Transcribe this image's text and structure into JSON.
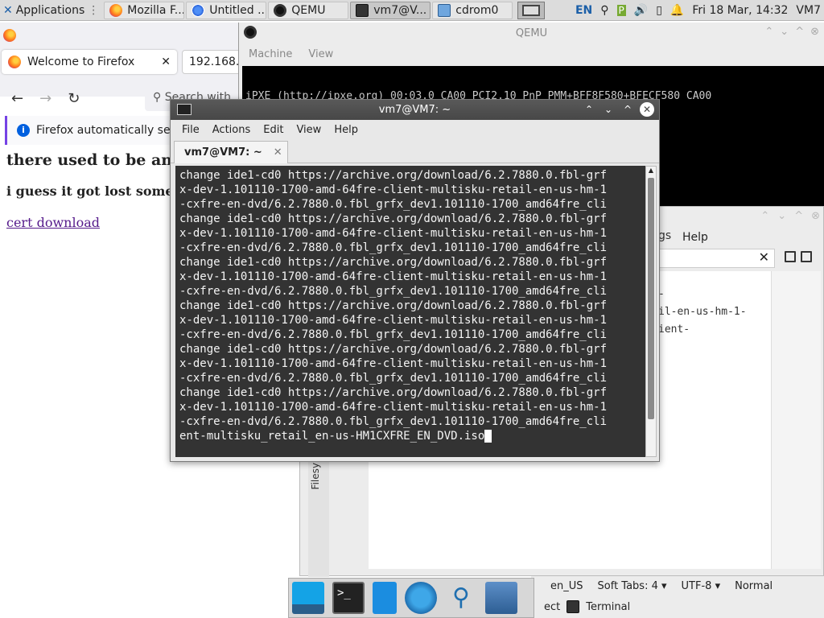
{
  "panel": {
    "applications_label": "Applications",
    "tasks": [
      {
        "label": "Mozilla F...",
        "icon": "firefox-icon"
      },
      {
        "label": "Untitled ...",
        "icon": "chromium-icon"
      },
      {
        "label": "QEMU",
        "icon": "qemu-icon"
      },
      {
        "label": "vm7@V...",
        "icon": "terminal-icon"
      },
      {
        "label": "cdrom0",
        "icon": "folder-icon"
      }
    ],
    "keyboard_layout": "EN",
    "datetime": "Fri 18 Mar, 14:32",
    "user": "VM7"
  },
  "firefox": {
    "tab_title": "Welcome to Firefox",
    "tab2_title": "192.168.",
    "search_placeholder": "Search with",
    "notice": "Firefox automatically sen",
    "heading": "there used to be an",
    "subheading": "i guess it got lost some",
    "link": "cert download"
  },
  "qemu": {
    "title": "QEMU",
    "menu": [
      "Machine",
      "View"
    ],
    "screen_text": "iPXE (http://ipxe.org) 00:03.0 CA00 PCI2.10 PnP PMM+BFF8F580+BFECF580 CA00"
  },
  "mousepad": {
    "menu_fragment": "gs",
    "help": "Help",
    "text_lines": [
      "-",
      "il-en-us-hm-1-",
      "",
      "ient-"
    ],
    "side_label": "Filesy"
  },
  "statusbar": {
    "language": "en_US",
    "tabs": "Soft Tabs: 4",
    "encoding": "UTF-8",
    "mode": "Normal"
  },
  "dockrow": {
    "fragment": "ect",
    "terminal_label": "Terminal"
  },
  "terminal": {
    "title": "vm7@VM7: ~",
    "menu": [
      "File",
      "Actions",
      "Edit",
      "View",
      "Help"
    ],
    "tab_label": "vm7@VM7: ~",
    "lines": [
      "change ide1-cd0 https://archive.org/download/6.2.7880.0.fbl-grf",
      "x-dev-1.101110-1700-amd-64fre-client-multisku-retail-en-us-hm-1",
      "-cxfre-en-dvd/6.2.7880.0.fbl_grfx_dev1.101110-1700_amd64fre_cli",
      "change ide1-cd0 https://archive.org/download/6.2.7880.0.fbl-grf",
      "x-dev-1.101110-1700-amd-64fre-client-multisku-retail-en-us-hm-1",
      "-cxfre-en-dvd/6.2.7880.0.fbl_grfx_dev1.101110-1700_amd64fre_cli",
      "change ide1-cd0 https://archive.org/download/6.2.7880.0.fbl-grf",
      "x-dev-1.101110-1700-amd-64fre-client-multisku-retail-en-us-hm-1",
      "-cxfre-en-dvd/6.2.7880.0.fbl_grfx_dev1.101110-1700_amd64fre_cli",
      "change ide1-cd0 https://archive.org/download/6.2.7880.0.fbl-grf",
      "x-dev-1.101110-1700-amd-64fre-client-multisku-retail-en-us-hm-1",
      "-cxfre-en-dvd/6.2.7880.0.fbl_grfx_dev1.101110-1700_amd64fre_cli",
      "change ide1-cd0 https://archive.org/download/6.2.7880.0.fbl-grf",
      "x-dev-1.101110-1700-amd-64fre-client-multisku-retail-en-us-hm-1",
      "-cxfre-en-dvd/6.2.7880.0.fbl_grfx_dev1.101110-1700_amd64fre_cli",
      "change ide1-cd0 https://archive.org/download/6.2.7880.0.fbl-grf",
      "x-dev-1.101110-1700-amd-64fre-client-multisku-retail-en-us-hm-1",
      "-cxfre-en-dvd/6.2.7880.0.fbl_grfx_dev1.101110-1700_amd64fre_cli"
    ],
    "last_line": "ent-multisku_retail_en-us-HM1CXFRE_EN_DVD.iso"
  }
}
